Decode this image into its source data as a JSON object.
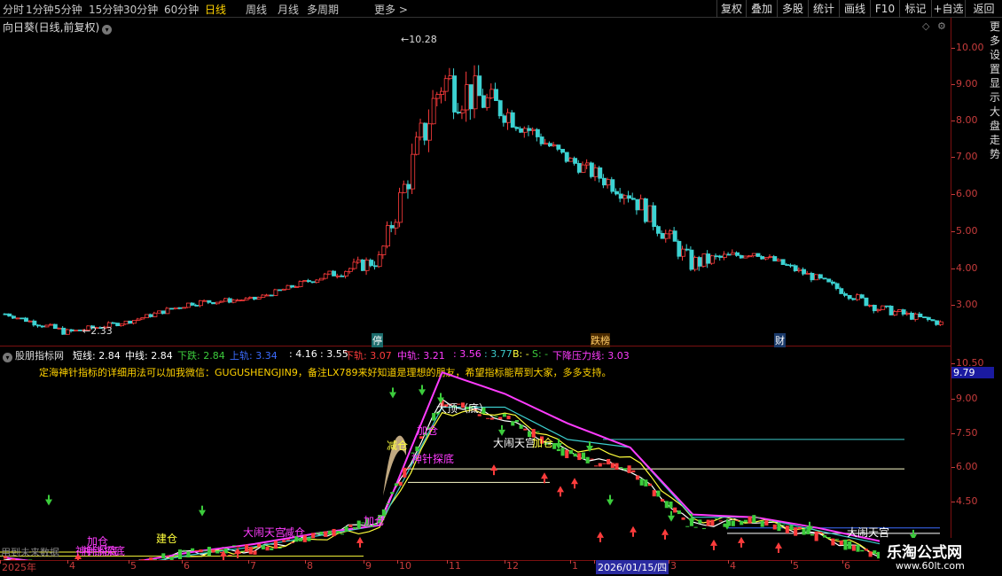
{
  "toolbar": {
    "periods": [
      "分时",
      "1分钟",
      "5分钟",
      "15分钟",
      "30分钟",
      "60分钟",
      "日线",
      "周线",
      "月线",
      "多周期",
      "更多 >"
    ],
    "active_period": "日线",
    "buttons": [
      "复权",
      "叠加",
      "多股",
      "统计",
      "画线",
      "F10",
      "标记",
      "+自选",
      "返回"
    ]
  },
  "main_chart": {
    "title": "向日葵(日线,前复权)",
    "y_ticks": [
      "10.00",
      "9.00",
      "8.00",
      "7.00",
      "6.00",
      "5.00",
      "4.00",
      "3.00"
    ],
    "high_label": "10.28",
    "low_label": "2.33",
    "events": [
      "停",
      "跌榜",
      "财"
    ],
    "right_strip": "更多设置显示大盘走势"
  },
  "indicator": {
    "name": "股朋指标网",
    "legend": [
      {
        "label": "短线: 2.84",
        "color": "#ffffff"
      },
      {
        "label": "中线: 2.84",
        "color": "#ffffff"
      },
      {
        "label": "下跌: 2.84",
        "color": "#3ccc3c"
      },
      {
        "label": "上轨: 3.34",
        "color": "#3c6cff"
      },
      {
        "label": ": 4.16",
        "color": "#ffffff"
      },
      {
        "label": ": 3.55",
        "color": "#ffffff"
      },
      {
        "label": "下轨: 3.07",
        "color": "#ff3c3c"
      },
      {
        "label": "中轨: 3.21",
        "color": "#ff3cff"
      },
      {
        "label": ": 3.56",
        "color": "#ff3cff"
      },
      {
        "label": ": 3.77",
        "color": "#3ccccc"
      },
      {
        "label": "B: -",
        "color": "#ffff3c"
      },
      {
        "label": "S: -",
        "color": "#3ccc3c"
      },
      {
        "label": "下降压力线: 3.03",
        "color": "#ff3cff"
      }
    ],
    "notice": "定海神针指标的详细用法可以加我微信：GUGUSHENGJIN9，备注LX789来好知道是理想的朋友，希望指标能帮到大家，多多支持。",
    "y_ticks": [
      "10.50",
      "9.00",
      "7.50",
      "6.00",
      "4.50"
    ],
    "current_value": "9.79",
    "annotations": [
      "大顶（底）",
      "大闹天宫",
      "神针探底",
      "加仓",
      "减仓",
      "加仓",
      "大闹天宫",
      "神针探底",
      "加仓",
      "减仓",
      "大闹天宫",
      "建仓",
      "神针探底",
      "加仓"
    ]
  },
  "dates": {
    "labels": [
      "2025年",
      "4",
      "5",
      "6",
      "7",
      "8",
      "9",
      "10",
      "11",
      "12",
      "1",
      "2026/01/15/四",
      "3",
      "4",
      "5",
      "6"
    ],
    "bottom_left": "用到未来数据"
  },
  "watermark": {
    "title": "乐淘公式网",
    "url": "www.60lt.com"
  },
  "colors": {
    "bg": "#000000",
    "up": "#ff3c3c",
    "down": "#3cd2d2",
    "axis": "#c83c3c",
    "accent": "#ffd200"
  },
  "chart_data": [
    {
      "type": "candlestick",
      "title": "向日葵(日线,前复权)",
      "ylim": [
        2.2,
        10.6
      ],
      "x": [
        "2025-03",
        "2025-04",
        "2025-05",
        "2025-06",
        "2025-07",
        "2025-08",
        "2025-09",
        "2025-10",
        "2025-11",
        "2025-12",
        "2026-01",
        "2026-02",
        "2026-03",
        "2026-04",
        "2026-05",
        "2026-06"
      ],
      "close": [
        3.05,
        2.55,
        2.85,
        3.35,
        3.45,
        4.0,
        4.5,
        9.3,
        8.5,
        7.2,
        6.3,
        4.4,
        4.7,
        4.0,
        3.2,
        2.8
      ],
      "high": [
        3.2,
        2.9,
        3.0,
        3.7,
        3.6,
        4.2,
        5.1,
        10.28,
        9.9,
        7.5,
        7.6,
        5.4,
        4.9,
        4.2,
        3.6,
        3.1
      ],
      "low": [
        2.9,
        2.33,
        2.7,
        3.2,
        3.3,
        3.7,
        3.8,
        5.9,
        7.8,
        6.6,
        5.9,
        4.0,
        4.3,
        3.6,
        2.9,
        2.6
      ]
    },
    {
      "type": "line",
      "title": "股朋指标网",
      "ylim": [
        3.5,
        10.8
      ],
      "x": [
        "2025-03",
        "2025-04",
        "2025-05",
        "2025-06",
        "2025-07",
        "2025-08",
        "2025-09",
        "2025-10",
        "2025-11",
        "2025-12",
        "2026-01",
        "2026-02",
        "2026-03",
        "2026-04",
        "2026-05",
        "2026-06"
      ],
      "series": [
        {
          "name": "短线",
          "values": [
            3.1,
            2.7,
            2.9,
            3.4,
            3.5,
            4.0,
            4.6,
            9.0,
            8.4,
            7.1,
            6.5,
            4.4,
            4.6,
            4.0,
            3.3,
            2.84
          ]
        },
        {
          "name": "中线",
          "values": [
            3.0,
            2.8,
            2.8,
            3.3,
            3.5,
            3.9,
            4.3,
            8.6,
            8.6,
            7.3,
            7.0,
            4.6,
            4.6,
            4.1,
            3.4,
            2.84
          ]
        },
        {
          "name": "中轨",
          "values": [
            3.2,
            2.9,
            2.9,
            3.3,
            3.6,
            4.0,
            4.4,
            8.8,
            8.8,
            7.6,
            7.3,
            4.7,
            4.7,
            4.2,
            3.7,
            3.21
          ]
        },
        {
          "name": "下降压力线",
          "values": [
            3.2,
            2.9,
            3.0,
            3.4,
            3.7,
            4.1,
            4.4,
            10.1,
            9.3,
            8.2,
            7.3,
            4.8,
            4.7,
            4.3,
            3.8,
            3.03
          ]
        }
      ]
    }
  ]
}
